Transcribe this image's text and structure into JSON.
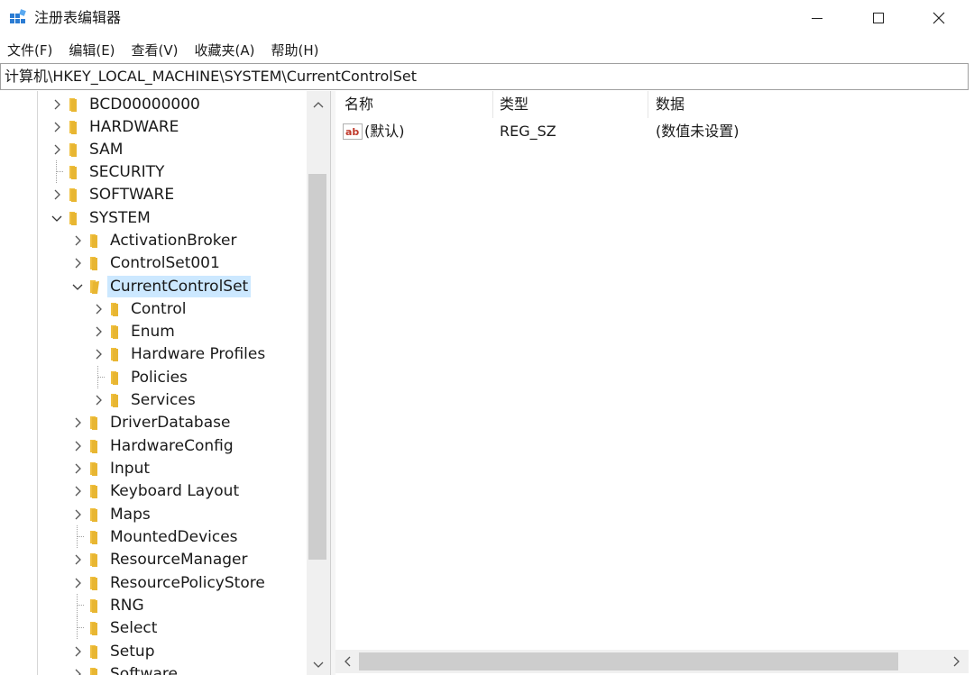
{
  "window": {
    "title": "注册表编辑器",
    "controls": {
      "minimize": "minimize-icon",
      "maximize": "maximize-icon",
      "close": "close-icon"
    }
  },
  "menu": {
    "items": [
      {
        "label": "文件(F)"
      },
      {
        "label": "编辑(E)"
      },
      {
        "label": "查看(V)"
      },
      {
        "label": "收藏夹(A)"
      },
      {
        "label": "帮助(H)"
      }
    ]
  },
  "address": {
    "path": "计算机\\HKEY_LOCAL_MACHINE\\SYSTEM\\CurrentControlSet"
  },
  "tree": {
    "items": [
      {
        "label": "BCD00000000"
      },
      {
        "label": "HARDWARE"
      },
      {
        "label": "SAM"
      },
      {
        "label": "SECURITY"
      },
      {
        "label": "SOFTWARE"
      },
      {
        "label": "SYSTEM"
      },
      {
        "label": "ActivationBroker"
      },
      {
        "label": "ControlSet001"
      },
      {
        "label": "CurrentControlSet"
      },
      {
        "label": "Control"
      },
      {
        "label": "Enum"
      },
      {
        "label": "Hardware Profiles"
      },
      {
        "label": "Policies"
      },
      {
        "label": "Services"
      },
      {
        "label": "DriverDatabase"
      },
      {
        "label": "HardwareConfig"
      },
      {
        "label": "Input"
      },
      {
        "label": "Keyboard Layout"
      },
      {
        "label": "Maps"
      },
      {
        "label": "MountedDevices"
      },
      {
        "label": "ResourceManager"
      },
      {
        "label": "ResourcePolicyStore"
      },
      {
        "label": "RNG"
      },
      {
        "label": "Select"
      },
      {
        "label": "Setup"
      },
      {
        "label": "Software"
      }
    ],
    "selected": "CurrentControlSet"
  },
  "values": {
    "columns": [
      {
        "label": "名称"
      },
      {
        "label": "类型"
      },
      {
        "label": "数据"
      }
    ],
    "rows": [
      {
        "name": "(默认)",
        "type": "REG_SZ",
        "data": "(数值未设置)"
      }
    ]
  },
  "colors": {
    "folder": "#e8b632",
    "selection": "#cce8ff",
    "accent": "#0078d7"
  }
}
